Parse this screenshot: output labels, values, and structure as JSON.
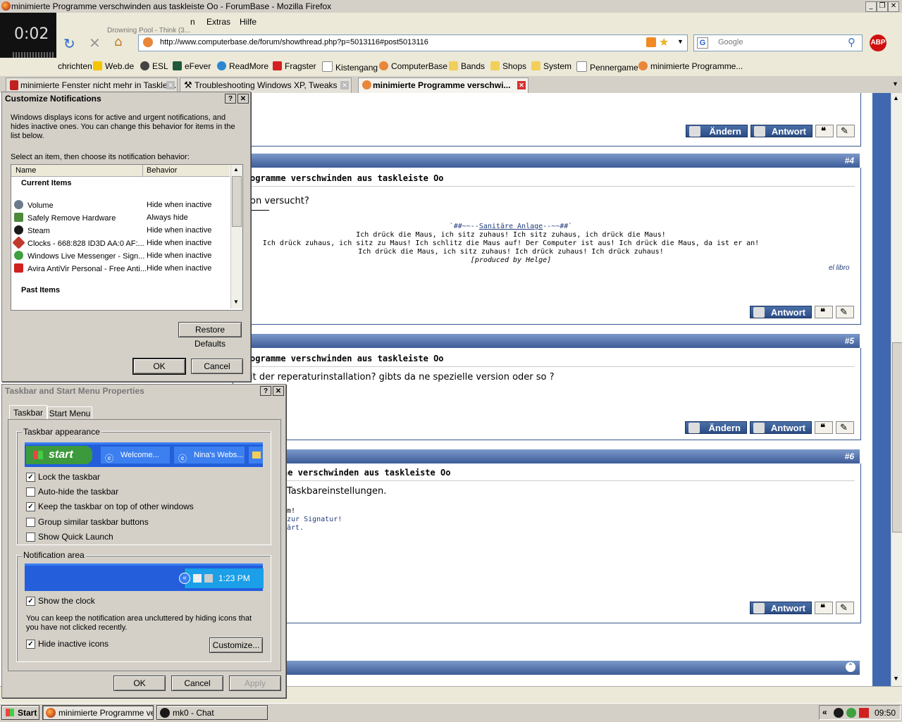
{
  "window": {
    "title": "minimierte Programme verschwinden aus taskleiste Oo - ForumBase - Mozilla Firefox"
  },
  "media_overlay": {
    "time": "0:02",
    "track": "Drowning Pool - Think (3..."
  },
  "menu": {
    "items": [
      "n",
      "Extras",
      "Hilfe"
    ]
  },
  "nav": {
    "url": "http://www.computerbase.de/forum/showthread.php?p=5013116#post5013116",
    "search_placeholder": "Google",
    "abp": "ABP"
  },
  "bookmarks": [
    "chrichten",
    "Web.de",
    "ESL",
    "eFever",
    "ReadMore",
    "Fragster",
    "Kistengang",
    "ComputerBase",
    "Bands",
    "Shops",
    "System",
    "Pennergame",
    "minimierte Programme..."
  ],
  "tabs": [
    {
      "label": "minimierte Fenster nicht mehr in Tasklei..."
    },
    {
      "label": "Troubleshooting Windows XP, Tweaks ..."
    },
    {
      "label": "minimierte Programme verschwi..."
    }
  ],
  "page": {
    "buttons": {
      "aendern": "Ändern",
      "antwort": "Antwort"
    },
    "post4": {
      "num": "#4",
      "title": "ogramme verschwinden aus taskleiste Oo",
      "text": "on versucht?",
      "sig_title_pre": "`##~~--",
      "sig_title_link": "Sanitäre Anlage",
      "sig_title_post": "--~~##`",
      "sig_lines": [
        "Ich drück die Maus, ich sitz zuhaus! Ich sitz zuhaus, ich drück die Maus!",
        "Ich drück zuhaus, ich sitz zu Maus! Ich schlitz die Maus auf! Der Computer ist aus! Ich drück die Maus, da ist er an!",
        "Ich drück die Maus, ich sitz zuhaus! Ich drück zuhaus! Ich drück zuhaus!"
      ],
      "sig_credit": "[produced by Helge]",
      "sig_right": "el libro"
    },
    "post5": {
      "num": "#5",
      "title": "ogramme verschwinden aus taskleiste Oo",
      "text": "it der reperaturinstallation? gibts da ne spezielle version oder so ?"
    },
    "post6": {
      "num": "#6",
      "title": "he verschwinden aus taskleiste Oo",
      "text": "Taskbareinstellungen.",
      "sig_lines": [
        "m!",
        "zur Signatur!",
        "ärt."
      ]
    }
  },
  "customize_dialog": {
    "title": "Customize Notifications",
    "help": "?",
    "close": "✕",
    "description": "Windows displays icons for active and urgent notifications, and hides inactive ones. You can change this behavior for items in the list below.",
    "prompt": "Select an item, then choose its notification behavior:",
    "columns": [
      "Name",
      "Behavior"
    ],
    "current_header": "Current Items",
    "items": [
      {
        "name": "Volume",
        "behavior": "Hide when inactive",
        "color": "#6a7a8a"
      },
      {
        "name": "Safely Remove Hardware",
        "behavior": "Always hide",
        "color": "#4a8a3a"
      },
      {
        "name": "Steam",
        "behavior": "Hide when inactive",
        "color": "#1a1a1a"
      },
      {
        "name": "Clocks - 668:828 ID3D AA:0 AF:...",
        "behavior": "Hide when inactive",
        "color": "#c0392b"
      },
      {
        "name": "Windows Live Messenger - Sign...",
        "behavior": "Hide when inactive",
        "color": "#3fa03f"
      },
      {
        "name": "Avira AntiVir Personal - Free Anti...",
        "behavior": "Hide when inactive",
        "color": "#d02020"
      }
    ],
    "past_header": "Past Items",
    "restore": "Restore Defaults",
    "ok": "OK",
    "cancel": "Cancel"
  },
  "taskbar_dialog": {
    "title": "Taskbar and Start Menu Properties",
    "help": "?",
    "close": "✕",
    "tabs": [
      "Taskbar",
      "Start Menu"
    ],
    "appearance_group": "Taskbar appearance",
    "preview": {
      "start": "start",
      "btn1": "Welcome...",
      "btn2": "Nina's Webs..."
    },
    "options": [
      {
        "label": "Lock the taskbar",
        "checked": true
      },
      {
        "label": "Auto-hide the taskbar",
        "checked": false
      },
      {
        "label": "Keep the taskbar on top of other windows",
        "checked": true
      },
      {
        "label": "Group similar taskbar buttons",
        "checked": false
      },
      {
        "label": "Show Quick Launch",
        "checked": false
      }
    ],
    "notif_group": "Notification area",
    "notif_time": "1:23 PM",
    "show_clock": {
      "label": "Show the clock",
      "checked": true
    },
    "notif_desc": "You can keep the notification area uncluttered by hiding icons that you have not clicked recently.",
    "hide_inactive": {
      "label": "Hide inactive icons",
      "checked": true
    },
    "customize": "Customize...",
    "ok": "OK",
    "cancel": "Cancel",
    "apply": "Apply"
  },
  "taskbar": {
    "start": "Start",
    "buttons": [
      "minimierte Programme ve...",
      "mk0 - Chat"
    ],
    "clock": "09:50",
    "tray_arrow": "«"
  }
}
